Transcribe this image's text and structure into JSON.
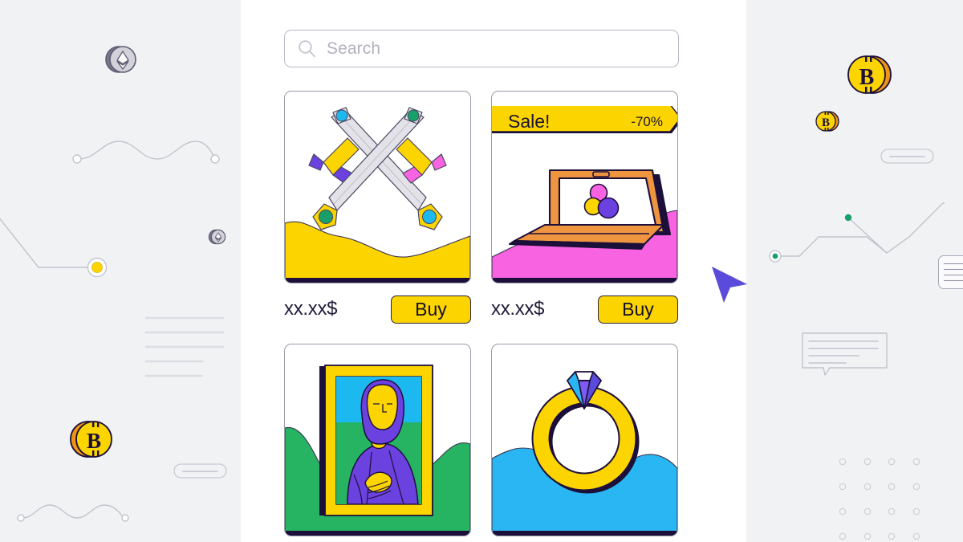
{
  "page": {
    "background_color": "#f1f2f4",
    "panel_color": "#ffffff",
    "accent_yellow": "#fcd400",
    "accent_dark": "#1c0f3a",
    "cursor_color": "#5b4bdb"
  },
  "search": {
    "placeholder": "Search",
    "value": "",
    "icon": "search-icon"
  },
  "products": [
    {
      "id": "crossed-swords",
      "artwork": "crossed-swords-illustration",
      "price": "xx.xx$",
      "buy_label": "Buy",
      "badge": null
    },
    {
      "id": "laptop",
      "artwork": "laptop-illustration",
      "price": "xx.xx$",
      "buy_label": "Buy",
      "badge": {
        "label": "Sale!",
        "discount": "-70%"
      }
    },
    {
      "id": "mona-lisa",
      "artwork": "mona-lisa-painting-illustration",
      "price": "",
      "buy_label": "",
      "badge": null
    },
    {
      "id": "diamond-ring",
      "artwork": "diamond-ring-illustration",
      "price": "",
      "buy_label": "",
      "badge": null
    }
  ],
  "scrollbar": {
    "thumb_icon": "document-lines-icon",
    "orientation": "vertical"
  },
  "cursor": {
    "icon": "mouse-pointer-icon"
  },
  "decorations": {
    "left": [
      "ethereum-coin-large",
      "ethereum-coin-small",
      "wavy-line-with-endpoints",
      "line-chart-yellow-node",
      "bitcoin-coin",
      "text-placeholder-lines",
      "pill-button-outline",
      "wavy-line-bottom"
    ],
    "right": [
      "bitcoin-coin-large",
      "bitcoin-coin-small",
      "pill-button-outline",
      "line-chart-green-nodes",
      "speech-bubble-icon",
      "dot-grid"
    ]
  }
}
